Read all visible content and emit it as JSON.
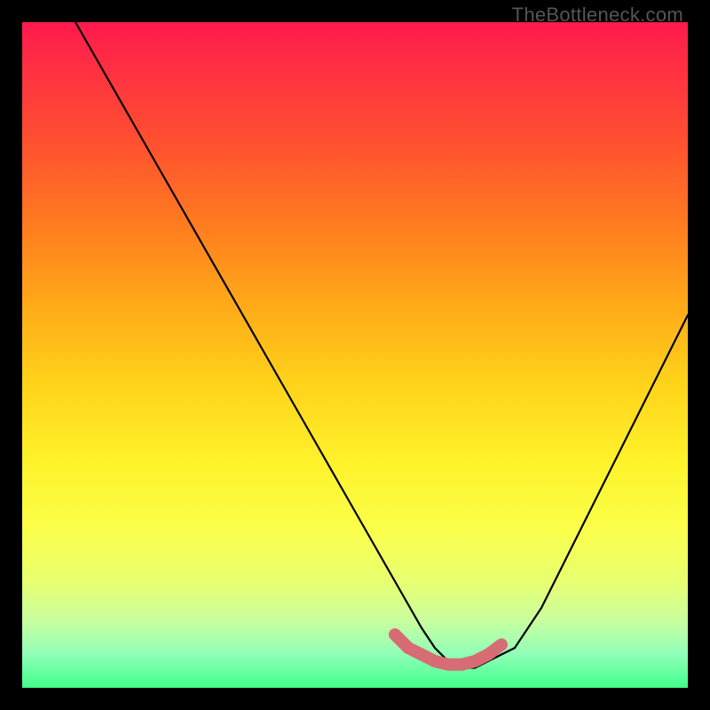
{
  "watermark": "TheBottleneck.com",
  "chart_data": {
    "type": "line",
    "title": "",
    "xlabel": "",
    "ylabel": "",
    "xlim": [
      0,
      100
    ],
    "ylim": [
      0,
      100
    ],
    "series": [
      {
        "name": "bottleneck-curve",
        "color": "#000000",
        "x": [
          8,
          12,
          16,
          20,
          24,
          28,
          32,
          36,
          40,
          44,
          48,
          52,
          56,
          60,
          62,
          64,
          66,
          68,
          70,
          74,
          78,
          82,
          86,
          90,
          94,
          98,
          100
        ],
        "y": [
          100,
          93,
          86,
          79,
          72,
          65,
          58,
          51,
          44,
          37,
          30,
          23,
          16,
          9,
          6,
          4,
          3,
          3,
          4,
          6,
          12,
          20,
          28,
          36,
          44,
          52,
          56
        ]
      },
      {
        "name": "highlight-bottom",
        "color": "#e07078",
        "x": [
          56,
          58,
          60,
          62,
          64,
          66,
          68,
          70,
          72
        ],
        "y": [
          8,
          6,
          5,
          4,
          3.5,
          3.5,
          4,
          5,
          6.5
        ]
      }
    ],
    "gradient_stops": [
      {
        "pos": 0,
        "color": "#ff1a4d"
      },
      {
        "pos": 50,
        "color": "#ffd21a"
      },
      {
        "pos": 100,
        "color": "#40ff8a"
      }
    ]
  }
}
